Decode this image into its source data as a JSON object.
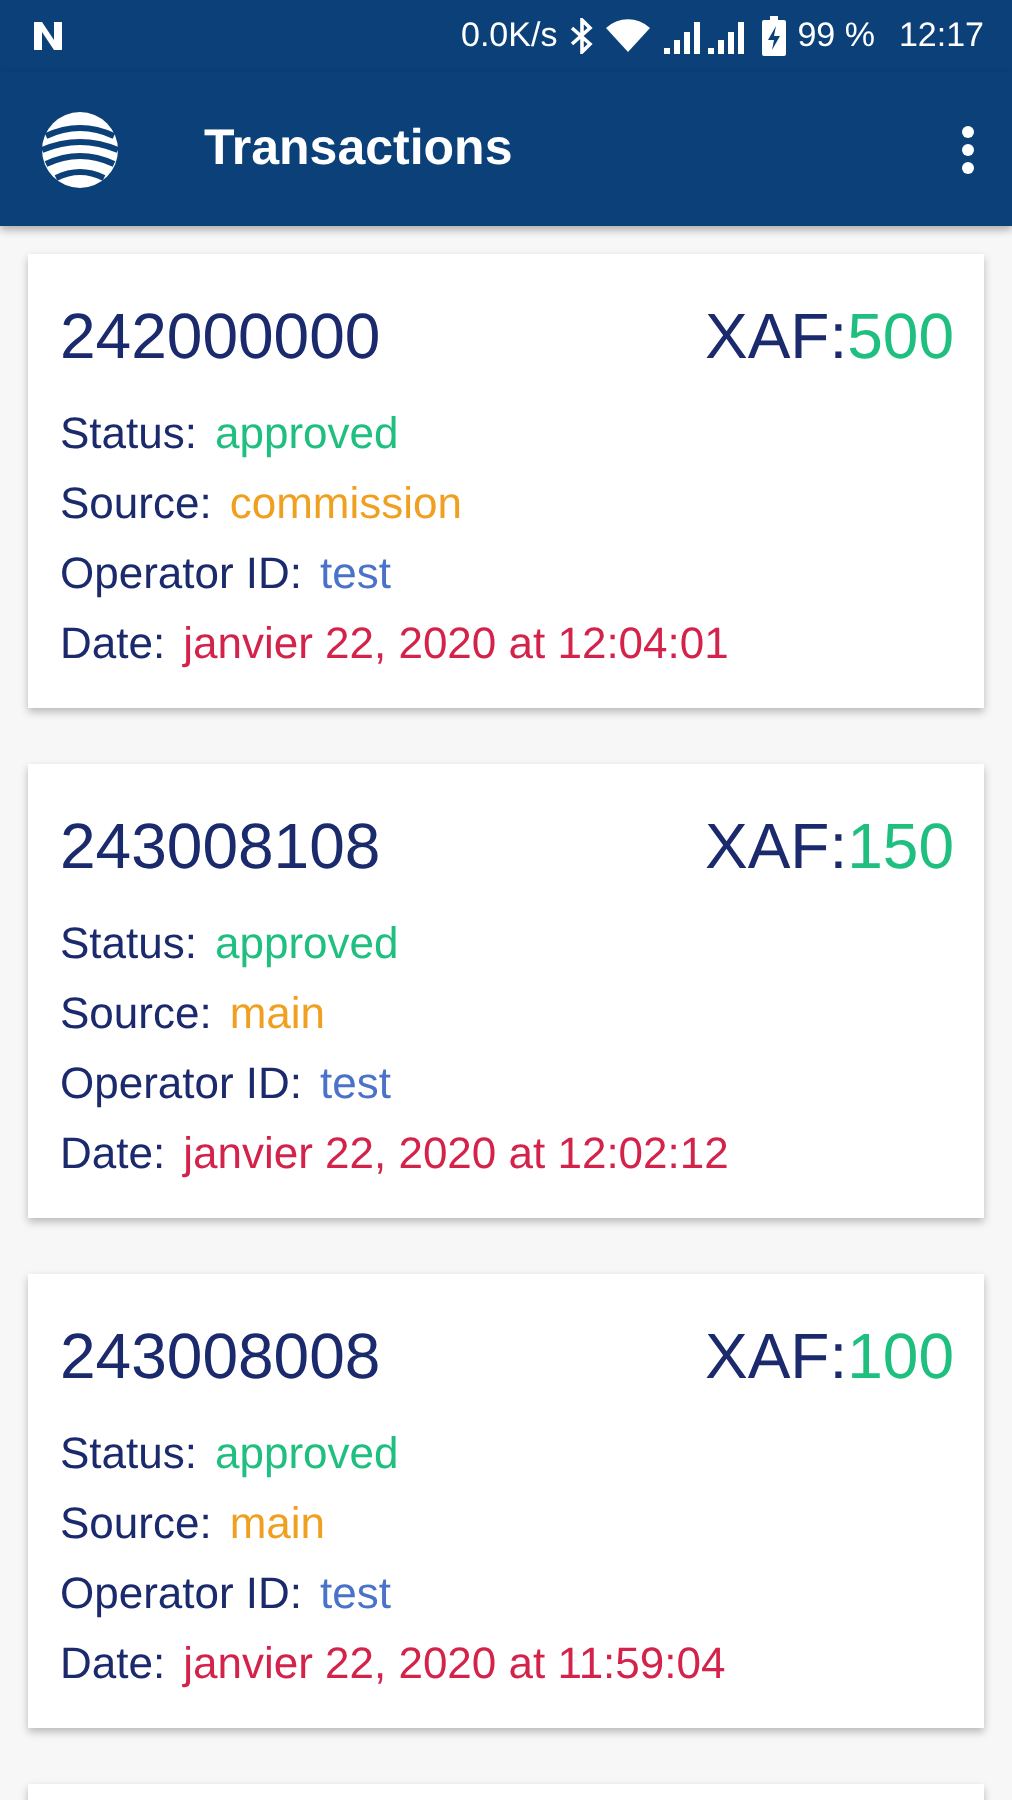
{
  "status_bar": {
    "network_speed": "0.0K/s",
    "battery": "99 %",
    "time": "12:17"
  },
  "app_bar": {
    "title": "Transactions"
  },
  "transactions": [
    {
      "number": "242000000",
      "currency": "XAF:",
      "amount": "500",
      "fields": [
        {
          "label": "Status:",
          "value": "approved",
          "color": "#1fbf7f"
        },
        {
          "label": "Source:",
          "value": "commission",
          "color": "#f0a020"
        },
        {
          "label": "Operator ID:",
          "value": "test",
          "color": "#4a72c8"
        },
        {
          "label": "Date:",
          "value": "janvier 22, 2020 at 12:04:01",
          "color": "#d4234a"
        }
      ]
    },
    {
      "number": "243008108",
      "currency": "XAF:",
      "amount": "150",
      "fields": [
        {
          "label": "Status:",
          "value": "approved",
          "color": "#1fbf7f"
        },
        {
          "label": "Source:",
          "value": "main",
          "color": "#f0a020"
        },
        {
          "label": "Operator ID:",
          "value": "test",
          "color": "#4a72c8"
        },
        {
          "label": "Date:",
          "value": "janvier 22, 2020 at 12:02:12",
          "color": "#d4234a"
        }
      ]
    },
    {
      "number": "243008008",
      "currency": "XAF:",
      "amount": "100",
      "fields": [
        {
          "label": "Status:",
          "value": "approved",
          "color": "#1fbf7f"
        },
        {
          "label": "Source:",
          "value": "main",
          "color": "#f0a020"
        },
        {
          "label": "Operator ID:",
          "value": "test",
          "color": "#4a72c8"
        },
        {
          "label": "Date:",
          "value": "janvier 22, 2020 at 11:59:04",
          "color": "#d4234a"
        }
      ]
    }
  ],
  "list_continues": true
}
